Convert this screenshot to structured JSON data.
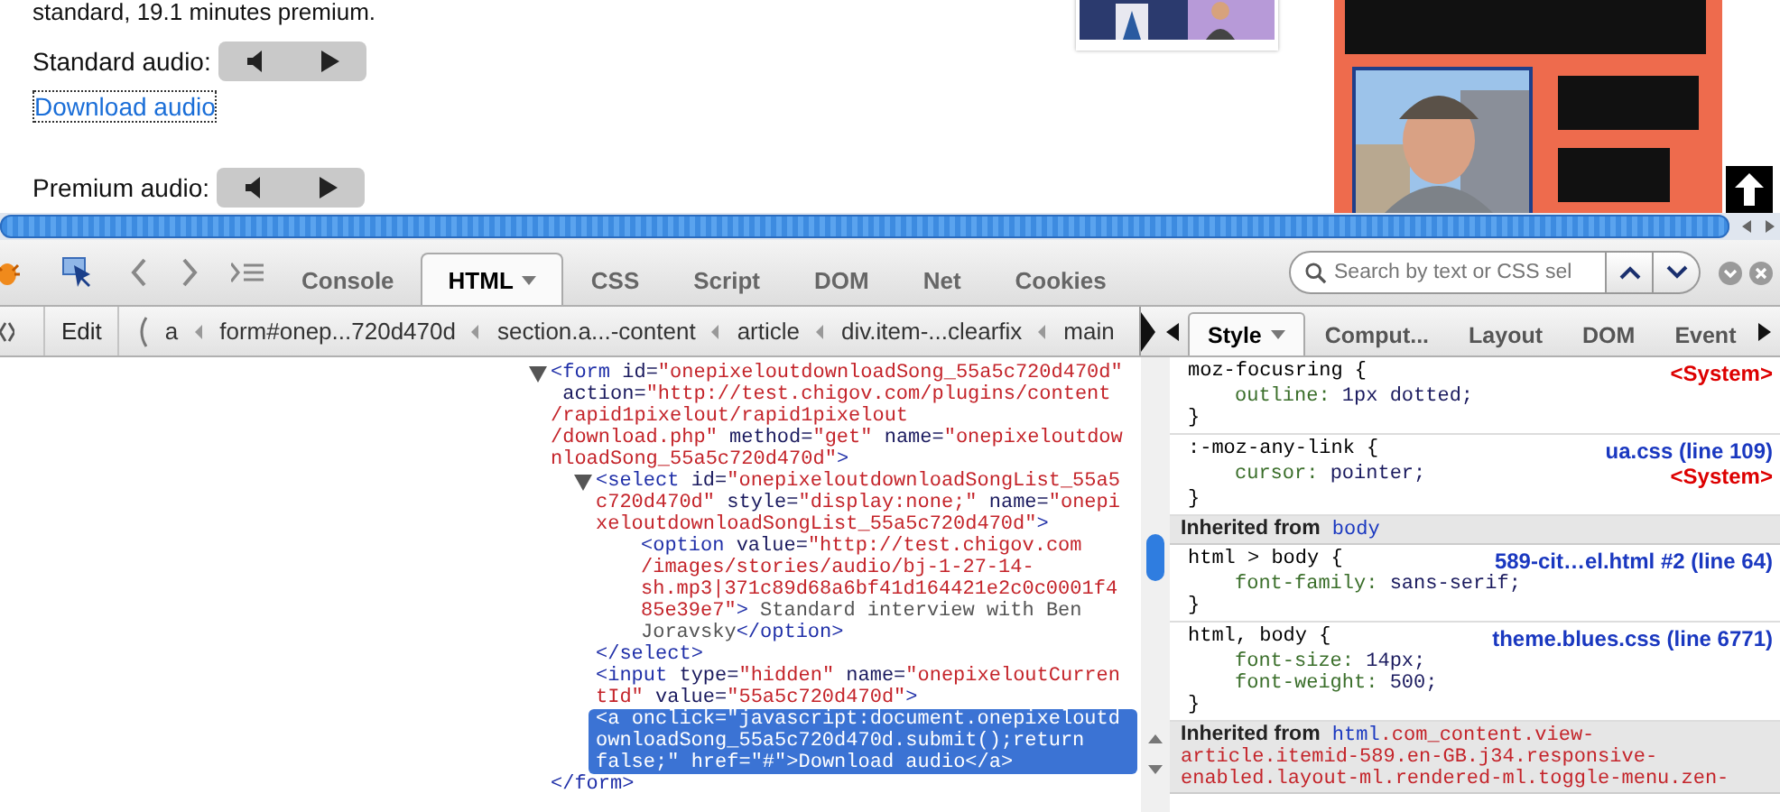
{
  "page": {
    "intro": "standard, 19.1 minutes premium.",
    "rows": [
      {
        "kind": "player",
        "label": "Standard audio:"
      },
      {
        "kind": "link",
        "text": "Download audio",
        "focused": true
      },
      {
        "kind": "player",
        "label": "Premium audio:"
      }
    ]
  },
  "toolbar": {
    "tabs": [
      {
        "label": "Console",
        "selected": false,
        "menu": false
      },
      {
        "label": "HTML",
        "selected": true,
        "menu": true
      },
      {
        "label": "CSS",
        "selected": false,
        "menu": false
      },
      {
        "label": "Script",
        "selected": false,
        "menu": false
      },
      {
        "label": "DOM",
        "selected": false,
        "menu": false
      },
      {
        "label": "Net",
        "selected": false,
        "menu": false
      },
      {
        "label": "Cookies",
        "selected": false,
        "menu": false
      }
    ],
    "search": {
      "placeholder": "Search by text or CSS sel"
    }
  },
  "breadcrumb_bar": {
    "edit": "Edit",
    "crumbs": [
      "a",
      "form#onep...720d470d",
      "section.a...-content",
      "article",
      "div.item-...clearfix",
      "main"
    ]
  },
  "side_tabs": [
    {
      "label": "Style",
      "selected": true,
      "menu": true
    },
    {
      "label": "Comput...",
      "selected": false,
      "menu": false
    },
    {
      "label": "Layout",
      "selected": false,
      "menu": false
    },
    {
      "label": "DOM",
      "selected": false,
      "menu": false
    },
    {
      "label": "Event",
      "selected": false,
      "menu": false
    }
  ],
  "html_tree": [
    {
      "kind": "container",
      "expanded": true,
      "selected": false,
      "lines": [
        "<form id=\"onepixeloutdownloadSong_55a5c720d470d\"",
        " action=\"http://test.chigov.com/plugins/content",
        "/rapid1pixelout/rapid1pixelout",
        "/download.php\" method=\"get\" name=\"onepixeloutdow",
        "nloadSong_55a5c720d470d\">"
      ],
      "closing": "</form>",
      "children": [
        {
          "kind": "container",
          "expanded": true,
          "selected": false,
          "lines": [
            "<select id=\"onepixeloutdownloadSongList_55a5",
            "c720d470d\" style=\"display:none;\" name=\"onepi",
            "xeloutdownloadSongList_55a5c720d470d\">"
          ],
          "closing": "</select>",
          "children": [
            {
              "kind": "leaf",
              "selected": false,
              "lines": [
                "<option value=\"http://test.chigov.com",
                "/images/stories/audio/bj-1-27-14-",
                "sh.mp3|371c89d68a6bf41d164421e2c0c0001f4",
                "85e39e7\"> Standard interview with Ben",
                "Joravsky</option>"
              ]
            }
          ]
        },
        {
          "kind": "leaf",
          "selected": false,
          "lines": [
            "<input type=\"hidden\" name=\"onepixeloutCurren",
            "tId\" value=\"55a5c720d470d\">"
          ]
        },
        {
          "kind": "leaf",
          "selected": true,
          "lines": [
            "<a onclick=\"javascript:document.onepixeloutd",
            "ownloadSong_55a5c720d470d.submit();return",
            "false;\" href=\"#\">Download audio</a>"
          ]
        }
      ]
    }
  ],
  "styles": [
    {
      "kind": "rule",
      "selector": "moz-focusring {",
      "selector_note": {
        "text": "<System>",
        "kind": "system"
      },
      "declarations": [
        {
          "text": "outline: 1px dotted;"
        }
      ],
      "closing": "}"
    },
    {
      "kind": "rule",
      "selector": ":-moz-any-link {",
      "selector_note": {
        "text": "ua.css (line 109)",
        "kind": "link"
      },
      "declarations": [
        {
          "text": "cursor: pointer;",
          "note": {
            "text": "<System>",
            "kind": "system"
          }
        }
      ],
      "closing": "}"
    },
    {
      "kind": "inherited",
      "label": "Inherited from",
      "element": "body"
    },
    {
      "kind": "rule",
      "selector": "html > body {",
      "selector_note": {
        "text": "589-cit…el.html #2 (line 64)",
        "kind": "link"
      },
      "declarations": [
        {
          "text": "font-family: sans-serif;"
        }
      ],
      "closing": "}"
    },
    {
      "kind": "rule",
      "selector": "html, body {",
      "selector_note": {
        "text": "theme.blues.css (line 6771)",
        "kind": "link"
      },
      "declarations": [
        {
          "text": "font-size: 14px;"
        },
        {
          "text": "font-weight: 500;"
        }
      ],
      "closing": "}"
    },
    {
      "kind": "inherited",
      "label": "Inherited from",
      "element": "html",
      "classes": [
        ".com_content.view-",
        "article.itemid-589.en-GB.j34.responsive-",
        "enabled.layout-ml.rendered-ml.toggle-menu.zen-"
      ]
    }
  ]
}
